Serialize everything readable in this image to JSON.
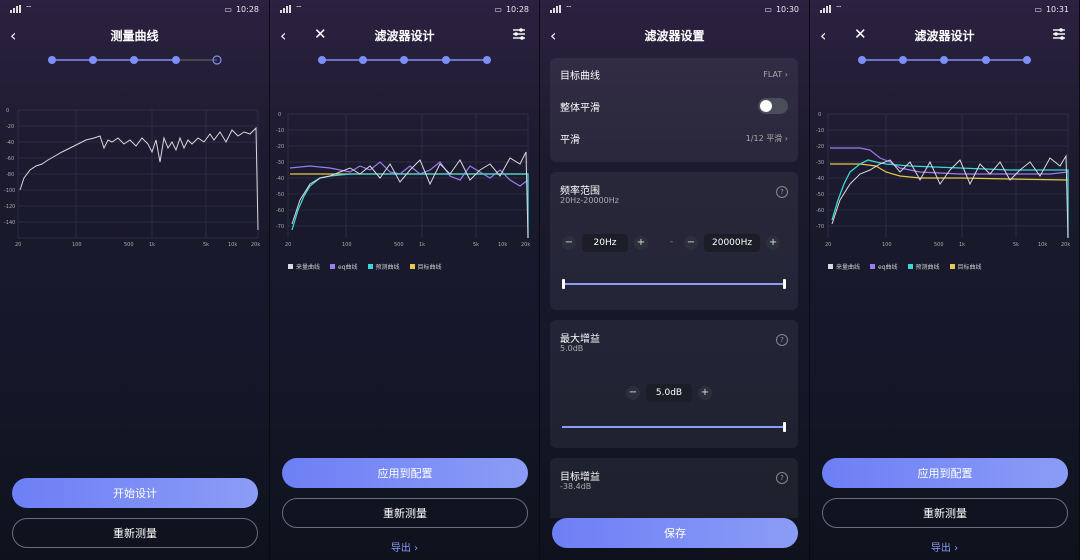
{
  "screens": [
    {
      "time": "10:28",
      "title": "测量曲线",
      "steps_total": 5,
      "steps_done": 4,
      "buttons": {
        "start_design": "开始设计",
        "remeasure": "重新测量"
      },
      "yticks": [
        "0",
        "-20",
        "-40",
        "-60",
        "-80",
        "-100",
        "-120",
        "-140"
      ],
      "xticks": [
        "20",
        "100",
        "500",
        "1k",
        "5k",
        "10k",
        "20k"
      ]
    },
    {
      "time": "10:28",
      "title": "滤波器设计",
      "yticks": [
        "0",
        "-10",
        "-20",
        "-30",
        "-40",
        "-50",
        "-60",
        "-70"
      ],
      "xticks": [
        "20",
        "100",
        "500",
        "1k",
        "5k",
        "10k",
        "20k"
      ],
      "legend": [
        "来量曲线",
        "eq曲线",
        "预测曲线",
        "目标曲线"
      ],
      "buttons": {
        "apply": "应用到配置",
        "remeasure": "重新测量",
        "export": "导出 ›"
      }
    },
    {
      "time": "10:30",
      "title": "滤波器设置",
      "target_curve": {
        "label": "目标曲线",
        "value": "FLAT ›"
      },
      "overall_smooth": {
        "label": "整体平滑"
      },
      "smooth": {
        "label": "平滑",
        "value": "1/12 平滑 ›"
      },
      "freq_range": {
        "label": "频率范围",
        "sub": "20Hz-20000Hz",
        "low": "20Hz",
        "high": "20000Hz"
      },
      "max_gain": {
        "label": "最大增益",
        "sub": "5.0dB",
        "value": "5.0dB"
      },
      "target_gain": {
        "label": "目标增益",
        "sub": "-38.4dB"
      },
      "save": "保存"
    },
    {
      "time": "10:31",
      "title": "滤波器设计",
      "yticks": [
        "0",
        "-10",
        "-20",
        "-30",
        "-40",
        "-50",
        "-60",
        "-70"
      ],
      "xticks": [
        "20",
        "100",
        "500",
        "1k",
        "5k",
        "10k",
        "20k"
      ],
      "legend": [
        "来量曲线",
        "eq曲线",
        "预测曲线",
        "目标曲线"
      ],
      "buttons": {
        "apply": "应用到配置",
        "remeasure": "重新测量",
        "export": "导出 ›"
      }
    }
  ],
  "colors": {
    "measured": "#d8d8e0",
    "eq": "#9b7cf0",
    "predicted": "#3dd6d6",
    "target": "#e6c84a",
    "accent": "#7d8ff6"
  }
}
